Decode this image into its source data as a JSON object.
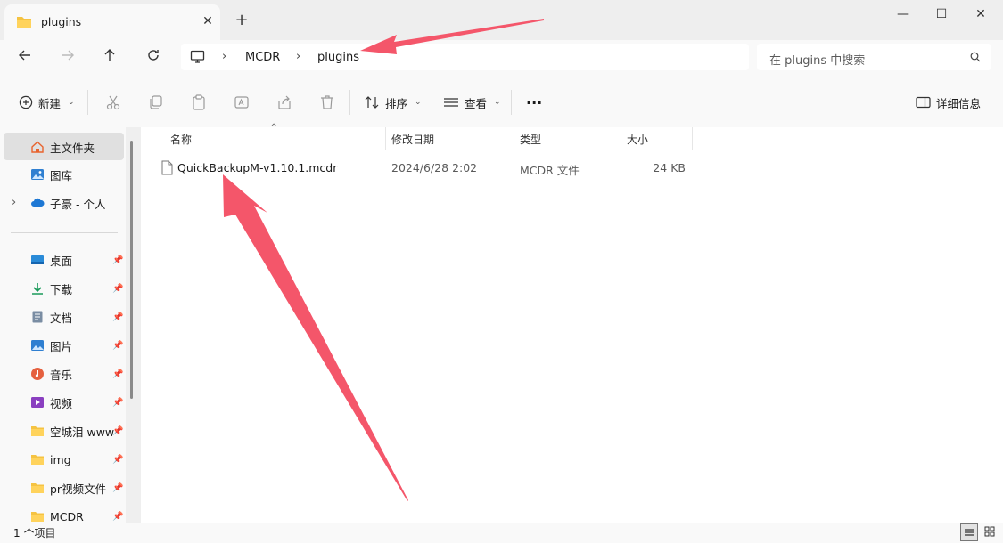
{
  "window": {
    "tab_title": "plugins",
    "new_tab": "+",
    "tab_close": "✕",
    "minimize": "—",
    "maximize": "☐",
    "close": "✕"
  },
  "nav": {
    "breadcrumbs": [
      "MCDR",
      "plugins"
    ],
    "search_placeholder": "在 plugins 中搜索"
  },
  "toolbar": {
    "new_label": "新建",
    "sort_label": "排序",
    "view_label": "查看",
    "more_label": "···",
    "details_label": "详细信息"
  },
  "sidebar": {
    "top": [
      {
        "label": "主文件夹",
        "icon": "home-icon"
      },
      {
        "label": "图库",
        "icon": "gallery-icon"
      },
      {
        "label": "子豪 - 个人",
        "icon": "onedrive-cloud-icon"
      }
    ],
    "quick": [
      {
        "label": "桌面",
        "icon": "desktop-icon"
      },
      {
        "label": "下载",
        "icon": "download-icon"
      },
      {
        "label": "文档",
        "icon": "documents-icon"
      },
      {
        "label": "图片",
        "icon": "pictures-icon"
      },
      {
        "label": "音乐",
        "icon": "music-icon"
      },
      {
        "label": "视频",
        "icon": "videos-icon"
      },
      {
        "label": "空城泪 www",
        "icon": "folder-icon"
      },
      {
        "label": "img",
        "icon": "folder-icon"
      },
      {
        "label": "pr视频文件",
        "icon": "folder-icon"
      },
      {
        "label": "MCDR",
        "icon": "folder-icon"
      }
    ]
  },
  "columns": {
    "name": "名称",
    "modified": "修改日期",
    "type": "类型",
    "size": "大小"
  },
  "files": [
    {
      "name": "QuickBackupM-v1.10.1.mcdr",
      "modified": "2024/6/28 2:02",
      "type": "MCDR 文件",
      "size": "24 KB"
    }
  ],
  "status": {
    "count": "1 个项目"
  },
  "colors": {
    "accent": "#005fb8",
    "annotation_arrow": "#f4566a",
    "folder": "#f5c342"
  }
}
